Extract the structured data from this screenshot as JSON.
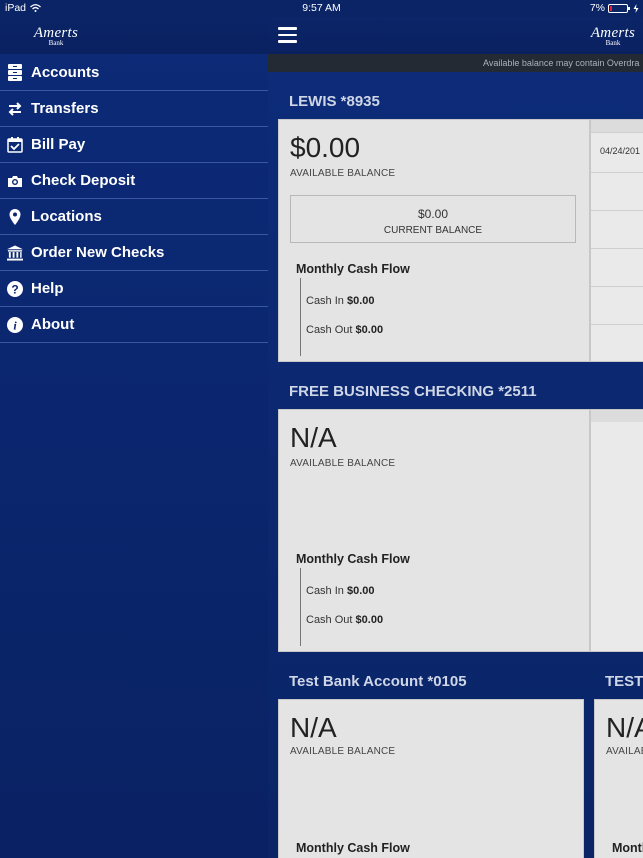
{
  "statusbar": {
    "device": "iPad",
    "time": "9:57 AM",
    "battery": "7%"
  },
  "brand": {
    "name": "Amerts",
    "sub": "Bank"
  },
  "menu": {
    "items": [
      {
        "label": "Accounts",
        "icon": "accounts-icon"
      },
      {
        "label": "Transfers",
        "icon": "transfers-icon"
      },
      {
        "label": "Bill Pay",
        "icon": "calendar-check-icon"
      },
      {
        "label": "Check Deposit",
        "icon": "camera-icon"
      },
      {
        "label": "Locations",
        "icon": "location-pin-icon"
      },
      {
        "label": "Order New Checks",
        "icon": "bank-icon"
      },
      {
        "label": "Help",
        "icon": "help-icon"
      },
      {
        "label": "About",
        "icon": "info-icon"
      }
    ]
  },
  "notice": "Available balance may contain Overdra",
  "accounts": [
    {
      "title": "LEWIS *8935",
      "available": "$0.00",
      "available_label": "AVAILABLE BALANCE",
      "current": "$0.00",
      "current_label": "CURRENT BALANCE",
      "cash_flow_title": "Monthly Cash Flow",
      "cash_in_label": "Cash In",
      "cash_in": "$0.00",
      "cash_out_label": "Cash Out",
      "cash_out": "$0.00",
      "date": "04/24/201"
    },
    {
      "title": "FREE BUSINESS CHECKING *2511",
      "available": "N/A",
      "available_label": "AVAILABLE BALANCE",
      "cash_flow_title": "Monthly Cash Flow",
      "cash_in_label": "Cash In",
      "cash_in": "$0.00",
      "cash_out_label": "Cash Out",
      "cash_out": "$0.00"
    },
    {
      "title": "Test Bank Account  *0105",
      "available": "N/A",
      "available_label": "AVAILABLE BALANCE",
      "cash_flow_title": "Monthly Cash Flow"
    },
    {
      "title": "TEST",
      "available": "N/A",
      "available_label": "AVAILABLE BALANCE",
      "cash_flow_title": "Monthly Cash Flow"
    }
  ]
}
